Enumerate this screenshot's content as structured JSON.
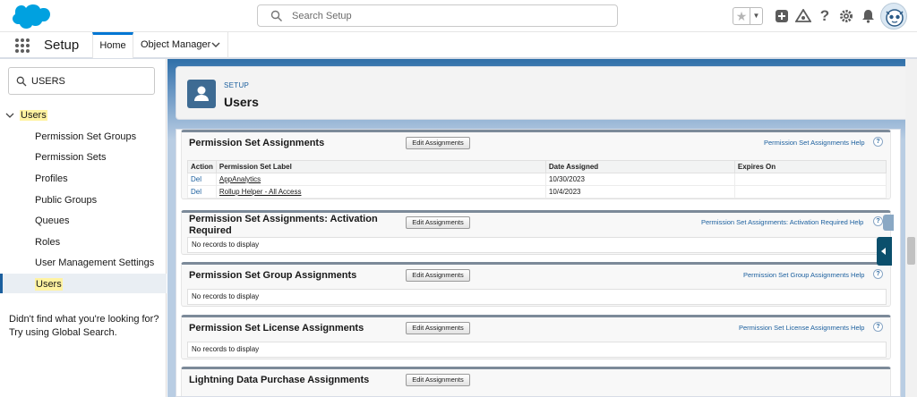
{
  "header": {
    "search_placeholder": "Search Setup",
    "icons": [
      "favorites-star-icon",
      "add-icon",
      "trailhead-icon",
      "help-icon",
      "gear-icon",
      "bell-icon",
      "avatar"
    ]
  },
  "appnav": {
    "app_name": "Setup",
    "tabs": [
      {
        "label": "Home",
        "active": true
      },
      {
        "label": "Object Manager",
        "active": false
      }
    ]
  },
  "sidebar": {
    "search_value": "USERS",
    "root_label": "Users",
    "items": [
      {
        "label": "Permission Set Groups"
      },
      {
        "label": "Permission Sets"
      },
      {
        "label": "Profiles"
      },
      {
        "label": "Public Groups"
      },
      {
        "label": "Queues"
      },
      {
        "label": "Roles"
      },
      {
        "label": "User Management Settings"
      },
      {
        "label": "Users",
        "selected": true
      }
    ],
    "footer_line1": "Didn't find what you're looking for?",
    "footer_line2": "Try using Global Search."
  },
  "page_header": {
    "kicker": "SETUP",
    "title": "Users"
  },
  "sections": [
    {
      "title": "Permission Set Assignments",
      "button": "Edit Assignments",
      "help": "Permission Set Assignments Help",
      "table": {
        "headers": [
          "Action",
          "Permission Set Label",
          "Date Assigned",
          "Expires On"
        ],
        "rows": [
          {
            "action": "Del",
            "label": "AppAnalytics",
            "date": "10/30/2023",
            "expires": ""
          },
          {
            "action": "Del",
            "label": "Rollup Helper - All Access",
            "date": "10/4/2023",
            "expires": ""
          }
        ]
      }
    },
    {
      "title_line1": "Permission Set Assignments: Activation",
      "title_line2": "Required",
      "button": "Edit Assignments",
      "help": "Permission Set Assignments: Activation Required Help",
      "empty": "No records to display"
    },
    {
      "title": "Permission Set Group Assignments",
      "button": "Edit Assignments",
      "help": "Permission Set Group Assignments Help",
      "empty": "No records to display"
    },
    {
      "title": "Permission Set License Assignments",
      "button": "Edit Assignments",
      "help": "Permission Set License Assignments Help",
      "empty": "No records to display"
    },
    {
      "title": "Lightning Data Purchase Assignments",
      "button": "Edit Assignments"
    }
  ],
  "help_glyph": "?",
  "colors": {
    "brand_blue": "#0176d3",
    "link_blue": "#1b5f9e",
    "highlight": "#fff3a1",
    "header_icon_bg": "#3e6b93"
  }
}
